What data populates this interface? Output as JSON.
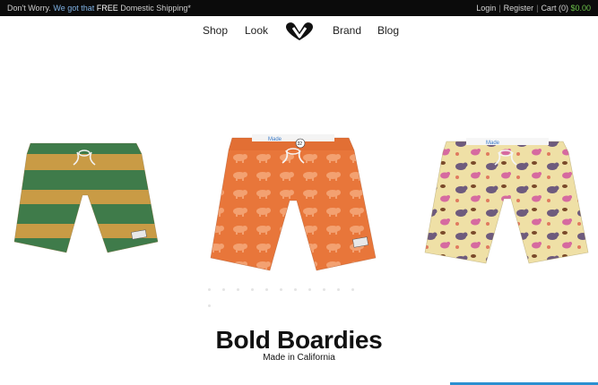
{
  "topbar": {
    "promo_part1": "Don't Worry. ",
    "promo_accent": "We got that",
    "promo_part2": " FREE",
    "promo_part3": " Domestic Shipping*",
    "login": "Login",
    "register": "Register",
    "cart_label": "Cart (0)",
    "cart_total": "$0.00"
  },
  "nav": {
    "items": [
      "Shop",
      "Look",
      "Brand",
      "Blog"
    ]
  },
  "products": [
    {
      "name": "green-orange-stripe-boardshorts"
    },
    {
      "name": "orange-bison-print-boardshorts",
      "size_tag": "32"
    },
    {
      "name": "yellow-bear-print-boardshorts"
    }
  ],
  "hero": {
    "headline": "Bold Boardies",
    "subline": "Made in California"
  },
  "colors": {
    "topbar_bg": "#0b0b0b",
    "accent_blue": "#7fb2e5",
    "cart_green": "#6cc24a",
    "stripe_green": "#3f7b4a",
    "stripe_orange": "#c99b45",
    "bison_orange": "#e8763a",
    "bear_yellow": "#efe0a6"
  }
}
